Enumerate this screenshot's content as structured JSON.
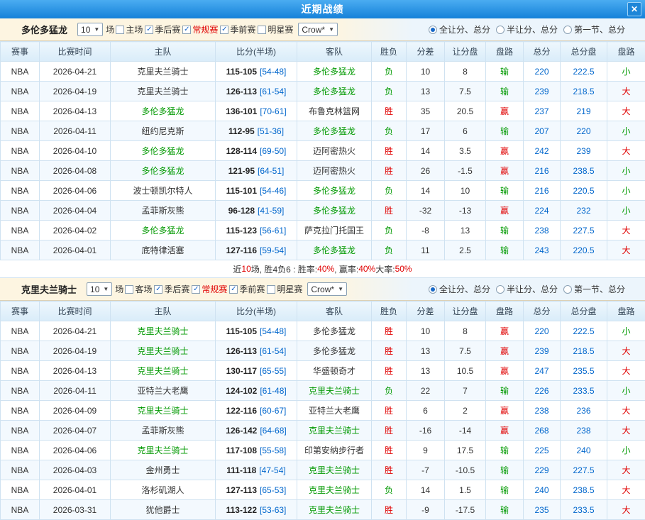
{
  "header": {
    "title": "近期战绩",
    "close_icon": "✕"
  },
  "sections": [
    {
      "team": "多伦多猛龙",
      "filter": {
        "count_value": "10",
        "games_label": "场",
        "checkboxes": [
          {
            "label": "主场",
            "checked": false,
            "red": false
          },
          {
            "label": "季后赛",
            "checked": true,
            "red": false
          },
          {
            "label": "常规赛",
            "checked": true,
            "red": true
          },
          {
            "label": "季前赛",
            "checked": true,
            "red": false
          },
          {
            "label": "明星赛",
            "checked": false,
            "red": false
          }
        ],
        "crow_value": "Crow*",
        "radios": [
          {
            "label": "全让分、总分",
            "selected": true
          },
          {
            "label": "半让分、总分",
            "selected": false
          },
          {
            "label": "第一节、总分",
            "selected": false
          }
        ]
      },
      "columns": [
        "赛事",
        "比赛时间",
        "主队",
        "比分(半场)",
        "客队",
        "胜负",
        "分差",
        "让分盘",
        "盘路",
        "总分",
        "总分盘",
        "盘路"
      ],
      "rows": [
        {
          "league": "NBA",
          "date": "2026-04-21",
          "home": {
            "text": "克里夫兰骑士",
            "focal": false
          },
          "score": "115-105",
          "half": "[54-48]",
          "away": {
            "text": "多伦多猛龙",
            "focal": true
          },
          "result": {
            "text": "负",
            "color": "green"
          },
          "diff": "10",
          "handicap": "8",
          "handicap_result": {
            "text": "输",
            "color": "green"
          },
          "total": "220",
          "total_line": "222.5",
          "big_small": {
            "text": "小",
            "color": "green"
          }
        },
        {
          "league": "NBA",
          "date": "2026-04-19",
          "home": {
            "text": "克里夫兰骑士",
            "focal": false
          },
          "score": "126-113",
          "half": "[61-54]",
          "away": {
            "text": "多伦多猛龙",
            "focal": true
          },
          "result": {
            "text": "负",
            "color": "green"
          },
          "diff": "13",
          "handicap": "7.5",
          "handicap_result": {
            "text": "输",
            "color": "green"
          },
          "total": "239",
          "total_line": "218.5",
          "big_small": {
            "text": "大",
            "color": "red"
          }
        },
        {
          "league": "NBA",
          "date": "2026-04-13",
          "home": {
            "text": "多伦多猛龙",
            "focal": true
          },
          "score": "136-101",
          "half": "[70-61]",
          "away": {
            "text": "布鲁克林篮网",
            "focal": false
          },
          "result": {
            "text": "胜",
            "color": "red"
          },
          "diff": "35",
          "handicap": "20.5",
          "handicap_result": {
            "text": "赢",
            "color": "red"
          },
          "total": "237",
          "total_line": "219",
          "big_small": {
            "text": "大",
            "color": "red"
          }
        },
        {
          "league": "NBA",
          "date": "2026-04-11",
          "home": {
            "text": "纽约尼克斯",
            "focal": false
          },
          "score": "112-95",
          "half": "[51-36]",
          "away": {
            "text": "多伦多猛龙",
            "focal": true
          },
          "result": {
            "text": "负",
            "color": "green"
          },
          "diff": "17",
          "handicap": "6",
          "handicap_result": {
            "text": "输",
            "color": "green"
          },
          "total": "207",
          "total_line": "220",
          "big_small": {
            "text": "小",
            "color": "green"
          }
        },
        {
          "league": "NBA",
          "date": "2026-04-10",
          "home": {
            "text": "多伦多猛龙",
            "focal": true
          },
          "score": "128-114",
          "half": "[69-50]",
          "away": {
            "text": "迈阿密热火",
            "focal": false
          },
          "result": {
            "text": "胜",
            "color": "red"
          },
          "diff": "14",
          "handicap": "3.5",
          "handicap_result": {
            "text": "赢",
            "color": "red"
          },
          "total": "242",
          "total_line": "239",
          "big_small": {
            "text": "大",
            "color": "red"
          }
        },
        {
          "league": "NBA",
          "date": "2026-04-08",
          "home": {
            "text": "多伦多猛龙",
            "focal": true
          },
          "score": "121-95",
          "half": "[64-51]",
          "away": {
            "text": "迈阿密热火",
            "focal": false
          },
          "result": {
            "text": "胜",
            "color": "red"
          },
          "diff": "26",
          "handicap": "-1.5",
          "handicap_result": {
            "text": "赢",
            "color": "red"
          },
          "total": "216",
          "total_line": "238.5",
          "big_small": {
            "text": "小",
            "color": "green"
          }
        },
        {
          "league": "NBA",
          "date": "2026-04-06",
          "home": {
            "text": "波士顿凯尔特人",
            "focal": false
          },
          "score": "115-101",
          "half": "[54-46]",
          "away": {
            "text": "多伦多猛龙",
            "focal": true
          },
          "result": {
            "text": "负",
            "color": "green"
          },
          "diff": "14",
          "handicap": "10",
          "handicap_result": {
            "text": "输",
            "color": "green"
          },
          "total": "216",
          "total_line": "220.5",
          "big_small": {
            "text": "小",
            "color": "green"
          }
        },
        {
          "league": "NBA",
          "date": "2026-04-04",
          "home": {
            "text": "孟菲斯灰熊",
            "focal": false
          },
          "score": "96-128",
          "half": "[41-59]",
          "away": {
            "text": "多伦多猛龙",
            "focal": true
          },
          "result": {
            "text": "胜",
            "color": "red"
          },
          "diff": "-32",
          "handicap": "-13",
          "handicap_result": {
            "text": "赢",
            "color": "red"
          },
          "total": "224",
          "total_line": "232",
          "big_small": {
            "text": "小",
            "color": "green"
          }
        },
        {
          "league": "NBA",
          "date": "2026-04-02",
          "home": {
            "text": "多伦多猛龙",
            "focal": true
          },
          "score": "115-123",
          "half": "[56-61]",
          "away": {
            "text": "萨克拉门托国王",
            "focal": false
          },
          "result": {
            "text": "负",
            "color": "green"
          },
          "diff": "-8",
          "handicap": "13",
          "handicap_result": {
            "text": "输",
            "color": "green"
          },
          "total": "238",
          "total_line": "227.5",
          "big_small": {
            "text": "大",
            "color": "red"
          }
        },
        {
          "league": "NBA",
          "date": "2026-04-01",
          "home": {
            "text": "底特律活塞",
            "focal": false
          },
          "score": "127-116",
          "half": "[59-54]",
          "away": {
            "text": "多伦多猛龙",
            "focal": true
          },
          "result": {
            "text": "负",
            "color": "green"
          },
          "diff": "11",
          "handicap": "2.5",
          "handicap_result": {
            "text": "输",
            "color": "green"
          },
          "total": "243",
          "total_line": "220.5",
          "big_small": {
            "text": "大",
            "color": "red"
          }
        }
      ],
      "summary": [
        {
          "text": "近 ",
          "color": "dark"
        },
        {
          "text": "10",
          "color": "red"
        },
        {
          "text": " 场, 胜4负6 : 胜率: ",
          "color": "dark"
        },
        {
          "text": "40%",
          "color": "red"
        },
        {
          "text": ", 赢率: ",
          "color": "dark"
        },
        {
          "text": "40%",
          "color": "red"
        },
        {
          "text": " 大率: ",
          "color": "dark"
        },
        {
          "text": "50%",
          "color": "red"
        }
      ]
    },
    {
      "team": "克里夫兰骑士",
      "filter": {
        "count_value": "10",
        "games_label": "场",
        "checkboxes": [
          {
            "label": "客场",
            "checked": false,
            "red": false
          },
          {
            "label": "季后赛",
            "checked": true,
            "red": false
          },
          {
            "label": "常规赛",
            "checked": true,
            "red": true
          },
          {
            "label": "季前赛",
            "checked": true,
            "red": false
          },
          {
            "label": "明星赛",
            "checked": false,
            "red": false
          }
        ],
        "crow_value": "Crow*",
        "radios": [
          {
            "label": "全让分、总分",
            "selected": true
          },
          {
            "label": "半让分、总分",
            "selected": false
          },
          {
            "label": "第一节、总分",
            "selected": false
          }
        ]
      },
      "columns": [
        "赛事",
        "比赛时间",
        "主队",
        "比分(半场)",
        "客队",
        "胜负",
        "分差",
        "让分盘",
        "盘路",
        "总分",
        "总分盘",
        "盘路"
      ],
      "rows": [
        {
          "league": "NBA",
          "date": "2026-04-21",
          "home": {
            "text": "克里夫兰骑士",
            "focal": true
          },
          "score": "115-105",
          "half": "[54-48]",
          "away": {
            "text": "多伦多猛龙",
            "focal": false
          },
          "result": {
            "text": "胜",
            "color": "red"
          },
          "diff": "10",
          "handicap": "8",
          "handicap_result": {
            "text": "赢",
            "color": "red"
          },
          "total": "220",
          "total_line": "222.5",
          "big_small": {
            "text": "小",
            "color": "green"
          }
        },
        {
          "league": "NBA",
          "date": "2026-04-19",
          "home": {
            "text": "克里夫兰骑士",
            "focal": true
          },
          "score": "126-113",
          "half": "[61-54]",
          "away": {
            "text": "多伦多猛龙",
            "focal": false
          },
          "result": {
            "text": "胜",
            "color": "red"
          },
          "diff": "13",
          "handicap": "7.5",
          "handicap_result": {
            "text": "赢",
            "color": "red"
          },
          "total": "239",
          "total_line": "218.5",
          "big_small": {
            "text": "大",
            "color": "red"
          }
        },
        {
          "league": "NBA",
          "date": "2026-04-13",
          "home": {
            "text": "克里夫兰骑士",
            "focal": true
          },
          "score": "130-117",
          "half": "[65-55]",
          "away": {
            "text": "华盛顿奇才",
            "focal": false
          },
          "result": {
            "text": "胜",
            "color": "red"
          },
          "diff": "13",
          "handicap": "10.5",
          "handicap_result": {
            "text": "赢",
            "color": "red"
          },
          "total": "247",
          "total_line": "235.5",
          "big_small": {
            "text": "大",
            "color": "red"
          }
        },
        {
          "league": "NBA",
          "date": "2026-04-11",
          "home": {
            "text": "亚特兰大老鹰",
            "focal": false
          },
          "score": "124-102",
          "half": "[61-48]",
          "away": {
            "text": "克里夫兰骑士",
            "focal": true
          },
          "result": {
            "text": "负",
            "color": "green"
          },
          "diff": "22",
          "handicap": "7",
          "handicap_result": {
            "text": "输",
            "color": "green"
          },
          "total": "226",
          "total_line": "233.5",
          "big_small": {
            "text": "小",
            "color": "green"
          }
        },
        {
          "league": "NBA",
          "date": "2026-04-09",
          "home": {
            "text": "克里夫兰骑士",
            "focal": true
          },
          "score": "122-116",
          "half": "[60-67]",
          "away": {
            "text": "亚特兰大老鹰",
            "focal": false
          },
          "result": {
            "text": "胜",
            "color": "red"
          },
          "diff": "6",
          "handicap": "2",
          "handicap_result": {
            "text": "赢",
            "color": "red"
          },
          "total": "238",
          "total_line": "236",
          "big_small": {
            "text": "大",
            "color": "red"
          }
        },
        {
          "league": "NBA",
          "date": "2026-04-07",
          "home": {
            "text": "孟菲斯灰熊",
            "focal": false
          },
          "score": "126-142",
          "half": "[64-68]",
          "away": {
            "text": "克里夫兰骑士",
            "focal": true
          },
          "result": {
            "text": "胜",
            "color": "red"
          },
          "diff": "-16",
          "handicap": "-14",
          "handicap_result": {
            "text": "赢",
            "color": "red"
          },
          "total": "268",
          "total_line": "238",
          "big_small": {
            "text": "大",
            "color": "red"
          }
        },
        {
          "league": "NBA",
          "date": "2026-04-06",
          "home": {
            "text": "克里夫兰骑士",
            "focal": true
          },
          "score": "117-108",
          "half": "[55-58]",
          "away": {
            "text": "印第安纳步行者",
            "focal": false
          },
          "result": {
            "text": "胜",
            "color": "red"
          },
          "diff": "9",
          "handicap": "17.5",
          "handicap_result": {
            "text": "输",
            "color": "green"
          },
          "total": "225",
          "total_line": "240",
          "big_small": {
            "text": "小",
            "color": "green"
          }
        },
        {
          "league": "NBA",
          "date": "2026-04-03",
          "home": {
            "text": "金州勇士",
            "focal": false
          },
          "score": "111-118",
          "half": "[47-54]",
          "away": {
            "text": "克里夫兰骑士",
            "focal": true
          },
          "result": {
            "text": "胜",
            "color": "red"
          },
          "diff": "-7",
          "handicap": "-10.5",
          "handicap_result": {
            "text": "输",
            "color": "green"
          },
          "total": "229",
          "total_line": "227.5",
          "big_small": {
            "text": "大",
            "color": "red"
          }
        },
        {
          "league": "NBA",
          "date": "2026-04-01",
          "home": {
            "text": "洛杉矶湖人",
            "focal": false
          },
          "score": "127-113",
          "half": "[65-53]",
          "away": {
            "text": "克里夫兰骑士",
            "focal": true
          },
          "result": {
            "text": "负",
            "color": "green"
          },
          "diff": "14",
          "handicap": "1.5",
          "handicap_result": {
            "text": "输",
            "color": "green"
          },
          "total": "240",
          "total_line": "238.5",
          "big_small": {
            "text": "大",
            "color": "red"
          }
        },
        {
          "league": "NBA",
          "date": "2026-03-31",
          "home": {
            "text": "犹他爵士",
            "focal": false
          },
          "score": "113-122",
          "half": "[53-63]",
          "away": {
            "text": "克里夫兰骑士",
            "focal": true
          },
          "result": {
            "text": "胜",
            "color": "red"
          },
          "diff": "-9",
          "handicap": "-17.5",
          "handicap_result": {
            "text": "输",
            "color": "green"
          },
          "total": "235",
          "total_line": "233.5",
          "big_small": {
            "text": "大",
            "color": "red"
          }
        }
      ],
      "summary": null
    }
  ]
}
